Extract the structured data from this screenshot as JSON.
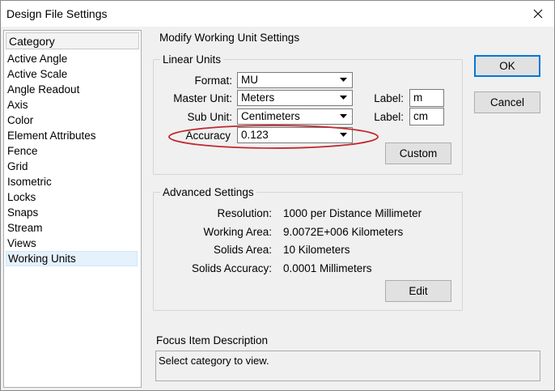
{
  "window": {
    "title": "Design File Settings"
  },
  "category_list": {
    "header": "Category",
    "items": [
      "Active Angle",
      "Active Scale",
      "Angle Readout",
      "Axis",
      "Color",
      "Element Attributes",
      "Fence",
      "Grid",
      "Isometric",
      "Locks",
      "Snaps",
      "Stream",
      "Views",
      "Working Units"
    ],
    "selected": "Working Units"
  },
  "panel": {
    "title": "Modify Working Unit Settings",
    "linear_units": {
      "group_label": "Linear Units",
      "format": {
        "label": "Format:",
        "value": "MU"
      },
      "master_unit": {
        "label": "Master Unit:",
        "value": "Meters",
        "tag_label": "Label:",
        "tag_value": "m"
      },
      "sub_unit": {
        "label": "Sub Unit:",
        "value": "Centimeters",
        "tag_label": "Label:",
        "tag_value": "cm"
      },
      "accuracy": {
        "label": "Accuracy",
        "value": "0.123"
      },
      "custom_button": "Custom"
    },
    "advanced": {
      "group_label": "Advanced Settings",
      "rows": [
        {
          "label": "Resolution:",
          "value": "1000 per Distance Millimeter"
        },
        {
          "label": "Working Area:",
          "value": "9.0072E+006 Kilometers"
        },
        {
          "label": "Solids Area:",
          "value": "10 Kilometers"
        },
        {
          "label": "Solids Accuracy:",
          "value": "0.0001 Millimeters"
        }
      ],
      "edit_button": "Edit"
    },
    "focus": {
      "group_label": "Focus Item Description",
      "text": "Select category to view."
    }
  },
  "buttons": {
    "ok": "OK",
    "cancel": "Cancel"
  },
  "colors": {
    "highlight_ellipse": "#c0282d",
    "default_button_border": "#0078d7",
    "selection_bg": "#e5f1fb"
  }
}
